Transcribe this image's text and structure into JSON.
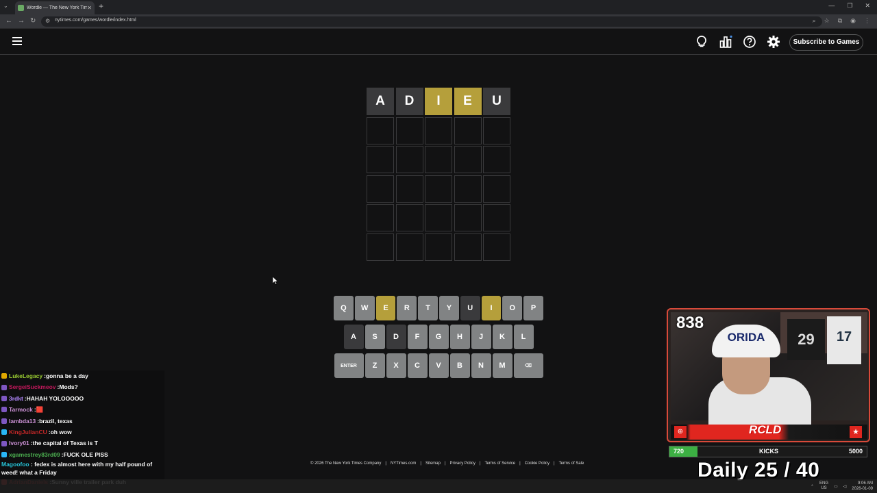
{
  "browser": {
    "tab_title": "Wordle — The New York Times",
    "url": "nytimes.com/games/wordle/index.html"
  },
  "header": {
    "subscribe_label": "Subscribe to Games"
  },
  "board": {
    "rows": [
      [
        {
          "letter": "A",
          "state": "absent"
        },
        {
          "letter": "D",
          "state": "absent"
        },
        {
          "letter": "I",
          "state": "present"
        },
        {
          "letter": "E",
          "state": "present"
        },
        {
          "letter": "U",
          "state": "absent"
        }
      ],
      [
        {
          "letter": "",
          "state": "empty"
        },
        {
          "letter": "",
          "state": "empty"
        },
        {
          "letter": "",
          "state": "empty"
        },
        {
          "letter": "",
          "state": "empty"
        },
        {
          "letter": "",
          "state": "empty"
        }
      ],
      [
        {
          "letter": "",
          "state": "empty"
        },
        {
          "letter": "",
          "state": "empty"
        },
        {
          "letter": "",
          "state": "empty"
        },
        {
          "letter": "",
          "state": "empty"
        },
        {
          "letter": "",
          "state": "empty"
        }
      ],
      [
        {
          "letter": "",
          "state": "empty"
        },
        {
          "letter": "",
          "state": "empty"
        },
        {
          "letter": "",
          "state": "empty"
        },
        {
          "letter": "",
          "state": "empty"
        },
        {
          "letter": "",
          "state": "empty"
        }
      ],
      [
        {
          "letter": "",
          "state": "empty"
        },
        {
          "letter": "",
          "state": "empty"
        },
        {
          "letter": "",
          "state": "empty"
        },
        {
          "letter": "",
          "state": "empty"
        },
        {
          "letter": "",
          "state": "empty"
        }
      ],
      [
        {
          "letter": "",
          "state": "empty"
        },
        {
          "letter": "",
          "state": "empty"
        },
        {
          "letter": "",
          "state": "empty"
        },
        {
          "letter": "",
          "state": "empty"
        },
        {
          "letter": "",
          "state": "empty"
        }
      ]
    ]
  },
  "keyboard": {
    "rows": [
      [
        {
          "k": "Q",
          "s": ""
        },
        {
          "k": "W",
          "s": ""
        },
        {
          "k": "E",
          "s": "present"
        },
        {
          "k": "R",
          "s": ""
        },
        {
          "k": "T",
          "s": ""
        },
        {
          "k": "Y",
          "s": ""
        },
        {
          "k": "U",
          "s": "absent"
        },
        {
          "k": "I",
          "s": "present"
        },
        {
          "k": "O",
          "s": ""
        },
        {
          "k": "P",
          "s": ""
        }
      ],
      [
        {
          "k": "A",
          "s": "absent"
        },
        {
          "k": "S",
          "s": ""
        },
        {
          "k": "D",
          "s": "absent"
        },
        {
          "k": "F",
          "s": ""
        },
        {
          "k": "G",
          "s": ""
        },
        {
          "k": "H",
          "s": ""
        },
        {
          "k": "J",
          "s": ""
        },
        {
          "k": "K",
          "s": ""
        },
        {
          "k": "L",
          "s": ""
        }
      ],
      [
        {
          "k": "ENTER",
          "s": "",
          "wide": true
        },
        {
          "k": "Z",
          "s": ""
        },
        {
          "k": "X",
          "s": ""
        },
        {
          "k": "C",
          "s": ""
        },
        {
          "k": "V",
          "s": ""
        },
        {
          "k": "B",
          "s": ""
        },
        {
          "k": "N",
          "s": ""
        },
        {
          "k": "M",
          "s": ""
        },
        {
          "k": "⌫",
          "s": "",
          "wide": true
        }
      ]
    ]
  },
  "footer": {
    "links": [
      "© 2026 The New York Times Company",
      "NYTimes.com",
      "Sitemap",
      "Privacy Policy",
      "Terms of Service",
      "Cookie Policy",
      "Terms of Sale"
    ]
  },
  "chat": {
    "messages": [
      {
        "name": "LukeLegacy",
        "color": "#9acd32",
        "badge": "#e0a800",
        "text": "gonna be a day"
      },
      {
        "name": "SergeiSuckmeov",
        "color": "#c2185b",
        "badge": "#7e57c2",
        "text": "Mods?"
      },
      {
        "name": "3rdkt",
        "color": "#b388ff",
        "badge": "#7e57c2",
        "text": "HAHAH YOLOOOOO"
      },
      {
        "name": "Tarmock",
        "color": "#ce93d8",
        "badge": "#7e57c2",
        "text": "🟥"
      },
      {
        "name": "lambda13",
        "color": "#ce93d8",
        "badge": "#7e57c2",
        "text": "brazil, texas"
      },
      {
        "name": "KingJulianCU",
        "color": "#c62828",
        "badge": "#29b6f6",
        "text": "oh wow"
      },
      {
        "name": "Ivory01",
        "color": "#ce93d8",
        "badge": "#7e57c2",
        "text": "the capital of Texas is T"
      },
      {
        "name": "xgamestrey83rd09",
        "color": "#4caf50",
        "badge": "#29b6f6",
        "text": "FUCK OLE PISS"
      },
      {
        "name": "Magoofoo",
        "color": "#26c6da",
        "badge": "#7e57c2",
        "text": "fedex is almost here with my half pound of weed! what a Friday"
      },
      {
        "name": "AdrianDaniels",
        "color": "#c62828",
        "badge": "#e53935",
        "text": "Sunny ville trailer park duh"
      }
    ]
  },
  "webcam": {
    "count": "838",
    "hat_text": "ORIDA",
    "jersey_number": "29",
    "jersey_number2": "17",
    "logo": "RCLD"
  },
  "kicks": {
    "current": "720",
    "label": "KICKS",
    "goal": "5000",
    "progress_fraction": 0.144
  },
  "daily": {
    "text": "Daily 25 / 40"
  },
  "taskbar": {
    "lang": "ENG",
    "region": "US",
    "time": "9:06 AM",
    "date": "2026-01-09"
  }
}
